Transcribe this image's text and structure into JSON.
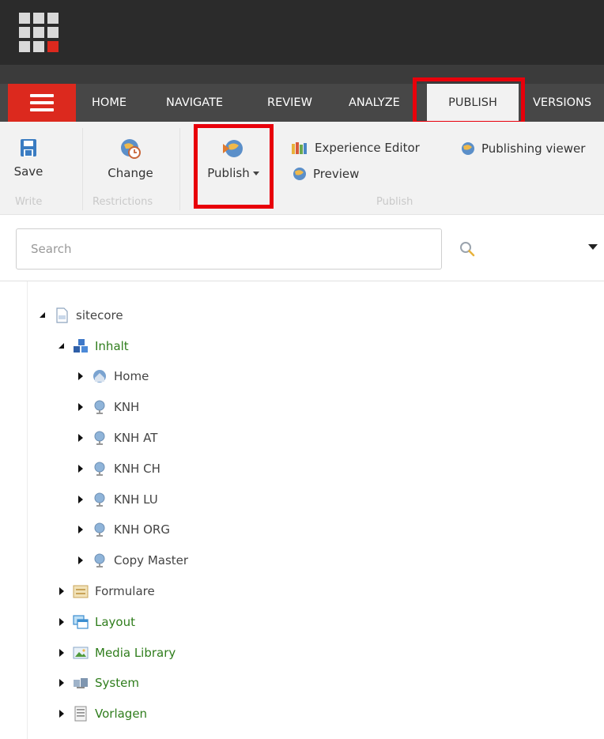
{
  "toolbar_tabs": [
    {
      "label": "HOME"
    },
    {
      "label": "NAVIGATE"
    },
    {
      "label": "REVIEW"
    },
    {
      "label": "ANALYZE"
    },
    {
      "label": "PUBLISH",
      "active": true
    },
    {
      "label": "VERSIONS"
    }
  ],
  "ribbon": {
    "write": {
      "save_label": "Save",
      "group_label": "Write"
    },
    "restrictions": {
      "change_label": "Change",
      "group_label": "Restrictions"
    },
    "publish": {
      "publish_label": "Publish",
      "experience_editor_label": "Experience Editor",
      "preview_label": "Preview",
      "publishing_viewer_label": "Publishing viewer",
      "group_label": "Publish"
    }
  },
  "search": {
    "placeholder": "Search",
    "value": ""
  },
  "tree": {
    "root": {
      "label": "sitecore",
      "icon": "document-icon"
    },
    "inhalt": {
      "label": "Inhalt",
      "icon": "content-cubes-icon"
    },
    "children": [
      {
        "label": "Home",
        "icon": "home-globe-icon"
      },
      {
        "label": "KNH",
        "icon": "site-globe-icon"
      },
      {
        "label": "KNH AT",
        "icon": "site-globe-icon"
      },
      {
        "label": "KNH CH",
        "icon": "site-globe-icon"
      },
      {
        "label": "KNH LU",
        "icon": "site-globe-icon"
      },
      {
        "label": "KNH ORG",
        "icon": "site-globe-icon"
      },
      {
        "label": "Copy Master",
        "icon": "site-globe-icon"
      }
    ],
    "siblings": [
      {
        "label": "Formulare",
        "icon": "forms-icon",
        "color": "grey"
      },
      {
        "label": "Layout",
        "icon": "layout-icon",
        "color": "green"
      },
      {
        "label": "Media Library",
        "icon": "media-library-icon",
        "color": "green"
      },
      {
        "label": "System",
        "icon": "system-icon",
        "color": "green"
      },
      {
        "label": "Vorlagen",
        "icon": "templates-icon",
        "color": "green"
      }
    ]
  },
  "colors": {
    "accent_red": "#dc291e",
    "highlight_red": "#e8000b",
    "tree_green": "#2f7d1c"
  }
}
